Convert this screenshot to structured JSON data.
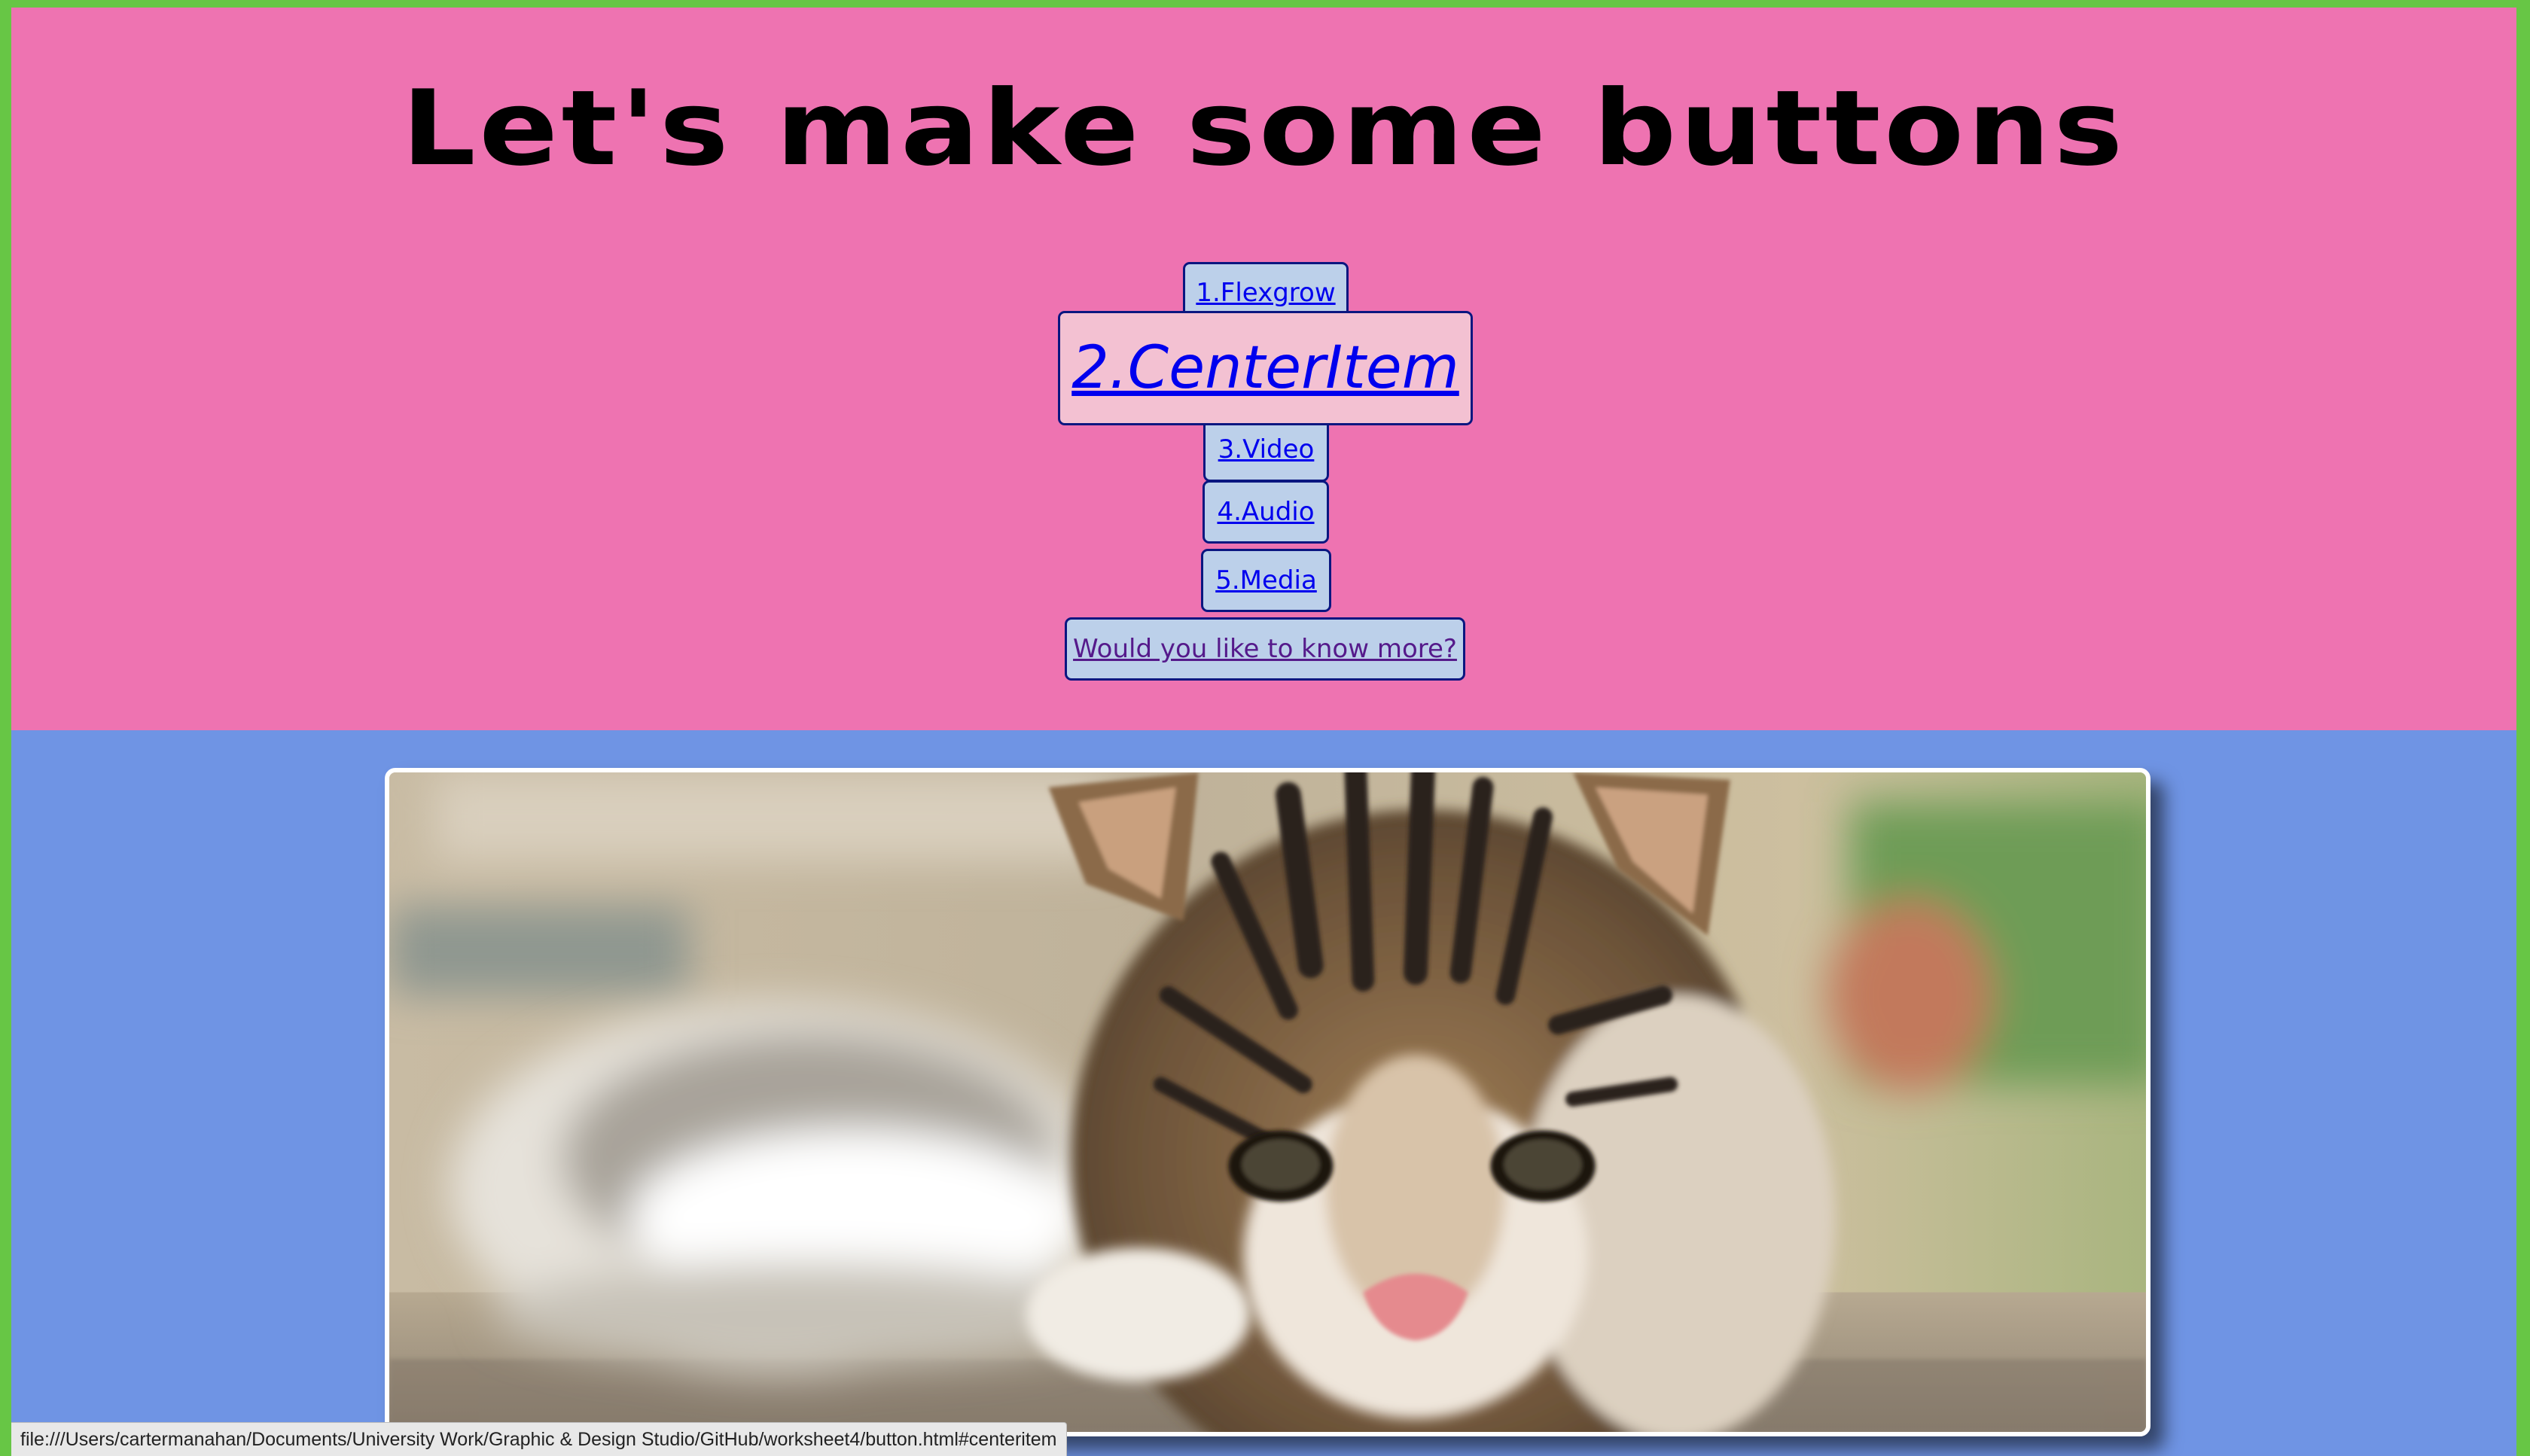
{
  "page": {
    "title": "Let's make some buttons",
    "status_url": "file:///Users/cartermanahan/Documents/University Work/Graphic & Design Studio/GitHub/worksheet4/button.html#centeritem"
  },
  "nav": {
    "items": [
      {
        "label": "1.Flexgrow"
      },
      {
        "label": "2.CenterItem"
      },
      {
        "label": "3.Video"
      },
      {
        "label": "4.Audio"
      },
      {
        "label": "5.Media"
      },
      {
        "label": "Would you like to know more?"
      }
    ],
    "active_index": 1
  },
  "image": {
    "subject": "kitten-photo"
  },
  "colors": {
    "page_border": "#67c645",
    "header_background": "#ee73b1",
    "main_background": "#6f94e4",
    "button_background": "#bcd0ea",
    "button_active_background": "#f3c1d2",
    "button_border": "#0a1680",
    "link_color": "#0000ee",
    "visited_link_color": "#551a8b"
  }
}
